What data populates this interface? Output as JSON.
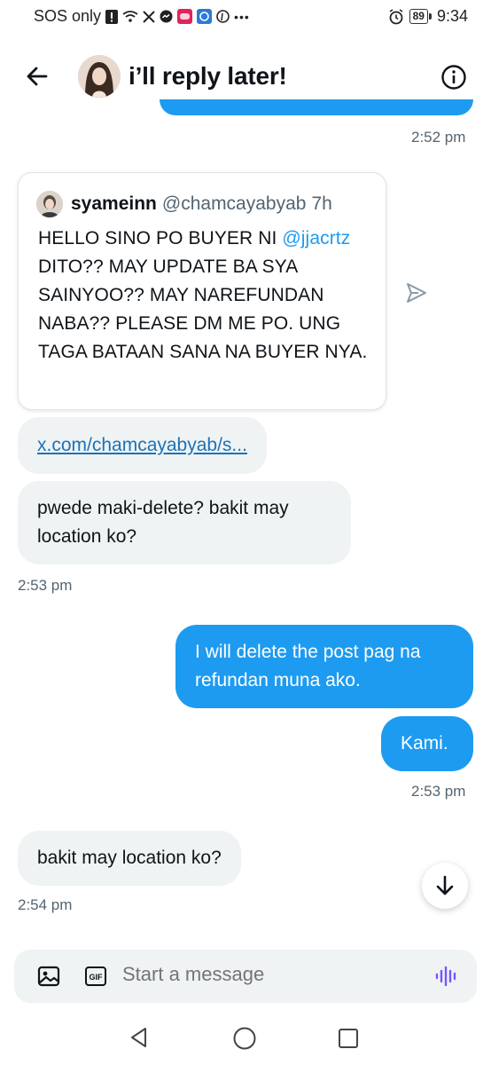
{
  "status_bar": {
    "carrier": "SOS only",
    "battery": "89",
    "time": "9:34"
  },
  "header": {
    "title": "i’ll reply later!"
  },
  "messages": {
    "ts1": "2:52 pm",
    "quote": {
      "name": "syameinn",
      "handle": "@chamcayabyab",
      "age": "7h",
      "text_before": "HELLO SINO PO BUYER NI ",
      "mention": "@jjacrtz",
      "text_after": " DITO?? MAY UPDATE BA SYA SAINYOO?? MAY NAREFUNDAN NABA?? PLEASE DM ME PO. UNG TAGA BATAAN SANA NA BUYER NYA."
    },
    "link": "x.com/chamcayabyab/s...",
    "in1": "pwede maki-delete? bakit may location ko?",
    "ts2": "2:53 pm",
    "out1": "I will delete the post pag na refundan muna ako.",
    "out2": "Kami.",
    "ts3": "2:53 pm",
    "in2": "bakit may location ko?",
    "ts4": "2:54 pm"
  },
  "composer": {
    "placeholder": "Start a message",
    "gif_label": "GIF"
  },
  "colors": {
    "accent": "#1d9bf0",
    "incoming_bubble": "#eff3f4",
    "muted_text": "#536471",
    "voice_icon": "#7856ff"
  },
  "icons": [
    "back-arrow-icon",
    "info-icon",
    "share-icon",
    "scroll-down-icon",
    "image-icon",
    "gif-icon",
    "voice-icon",
    "nav-back-icon",
    "nav-home-icon",
    "nav-recent-icon"
  ]
}
